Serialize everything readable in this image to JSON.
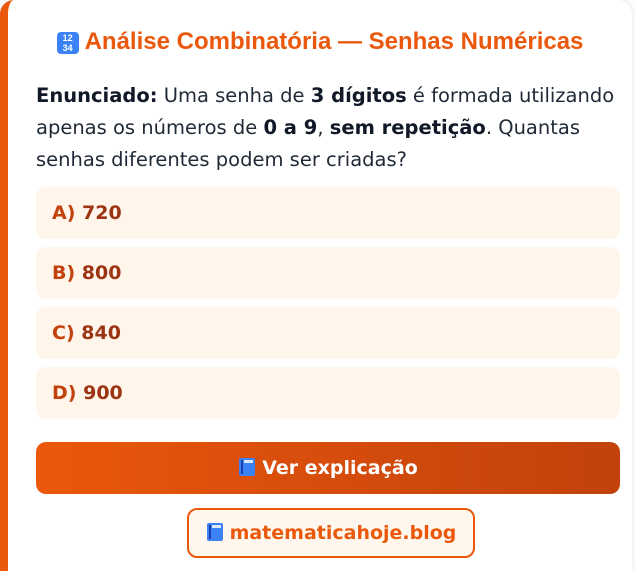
{
  "title": {
    "icon": "numbers-emoji-icon",
    "icon_text_top": "12",
    "icon_text_bottom": "34",
    "text": "Análise Combinatória — Senhas Numéricas"
  },
  "statement": {
    "label": "Enunciado:",
    "part1": " Uma senha de ",
    "bold1": "3 dígitos",
    "part2": " é formada utilizando apenas os números de ",
    "bold2": "0 a 9",
    "part3": ", ",
    "bold3": "sem repetição",
    "part4": ". Quantas senhas diferentes podem ser criadas?"
  },
  "options": [
    {
      "letter": "A)",
      "value": "720"
    },
    {
      "letter": "B)",
      "value": "800"
    },
    {
      "letter": "C)",
      "value": "840"
    },
    {
      "letter": "D)",
      "value": "900"
    }
  ],
  "explain_button": {
    "icon": "book-icon",
    "label": "Ver explicação"
  },
  "site_link": {
    "icon": "book-icon",
    "label": "matematicahoje.blog"
  },
  "colors": {
    "accent": "#ea580c",
    "accent_dark": "#c2410c",
    "option_bg": "#fff5ea",
    "text": "#1f2937"
  }
}
